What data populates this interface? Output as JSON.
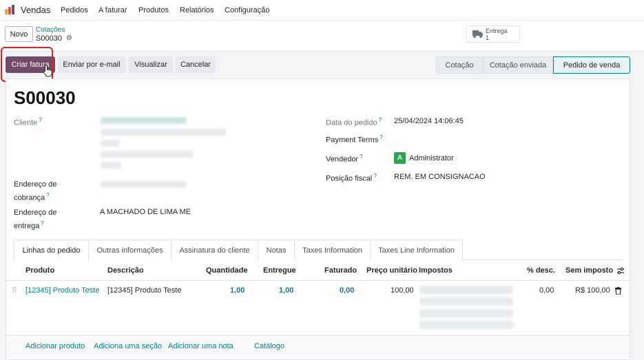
{
  "navbar": {
    "app_name": "Vendas",
    "menus": [
      "Pedidos",
      "A faturar",
      "Produtos",
      "Relatórios",
      "Configuração"
    ]
  },
  "control_panel": {
    "new_button": "Novo",
    "breadcrumb_parent": "Cotações",
    "breadcrumb_current": "S00030",
    "smart_button": {
      "label": "Entrega",
      "count": "1"
    }
  },
  "actions": {
    "create_invoice": "Criar fatura",
    "send_email": "Enviar por e-mail",
    "preview": "Visualizar",
    "cancel": "Cancelar"
  },
  "statusbar": {
    "stages": [
      "Cotação",
      "Cotação enviada",
      "Pedido de venda"
    ],
    "active": "Pedido de venda"
  },
  "form": {
    "title": "S00030",
    "customer_label": "Cliente",
    "invoice_address_label_1": "Endereço de",
    "invoice_address_label_2": "cobrança",
    "delivery_address_label_1": "Endereço de",
    "delivery_address_label_2": "entrega",
    "delivery_address": "A MACHADO DE LIMA ME",
    "order_date_label": "Data do pedido",
    "order_date": "25/04/2024 14:06:45",
    "payment_terms_label": "Payment Terms",
    "salesperson_label": "Vendedor",
    "salesperson_initial": "A",
    "salesperson": "Administrator",
    "fiscal_position_label": "Posição fiscal",
    "fiscal_position": "REM. EM CONSIGNACAO"
  },
  "tabs": [
    "Linhas do pedido",
    "Outras informações",
    "Assinatura do cliente",
    "Notas",
    "Taxes Information",
    "Taxes Line Information"
  ],
  "table": {
    "headers": {
      "product": "Produto",
      "description": "Descrição",
      "quantity": "Quantidade",
      "delivered": "Entregue",
      "invoiced": "Faturado",
      "unit_price": "Preço unitário",
      "taxes": "Impostos",
      "discount": "% desc.",
      "subtotal": "Sem imposto"
    },
    "rows": [
      {
        "product": "[12345] Produto Teste",
        "description": "[12345] Produto Teste",
        "quantity": "1,00",
        "delivered": "1,00",
        "invoiced": "0,00",
        "unit_price": "100,00",
        "discount": "0,00",
        "subtotal": "R$ 100,00"
      }
    ],
    "footer_links": [
      "Adicionar produto",
      "Adiciona uma seção",
      "Adicionar uma nota",
      "Catálogo"
    ]
  },
  "colors": {
    "brand": "#714b67",
    "link": "#017e84",
    "highlight": "#e02020"
  }
}
